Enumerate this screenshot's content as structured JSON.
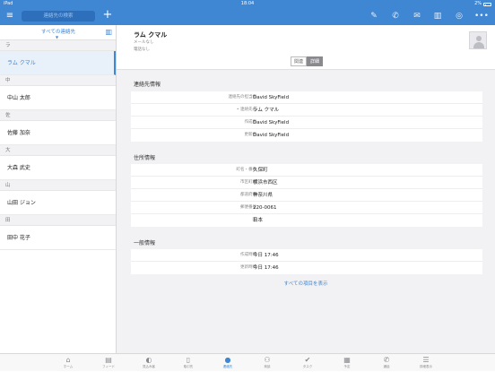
{
  "status_bar": {
    "carrier": "iPad",
    "time": "18:04",
    "battery": "2%"
  },
  "topbar": {
    "search_placeholder": "連絡先の検索",
    "add_label": "+",
    "icons": [
      "menu-icon",
      "pencil-icon",
      "phone-icon",
      "mail-icon",
      "book-icon",
      "location-icon",
      "more-icon"
    ]
  },
  "sidebar": {
    "filter_label": "すべての連絡先",
    "groups": [
      {
        "header": "ラ",
        "contacts": [
          "ラム クマル"
        ]
      },
      {
        "header": "中",
        "contacts": [
          "中山 太郎"
        ]
      },
      {
        "header": "佐",
        "contacts": [
          "佐藤 加奈"
        ]
      },
      {
        "header": "大",
        "contacts": [
          "大森 武史"
        ]
      },
      {
        "header": "山",
        "contacts": [
          "山田 ジョン"
        ]
      },
      {
        "header": "田",
        "contacts": [
          "田中 花子"
        ]
      }
    ],
    "selected": "ラム クマル"
  },
  "detail": {
    "name": "ラム クマル",
    "mail": "メールなし",
    "phone": "電話なし",
    "segments": {
      "related": "関連",
      "details": "詳細"
    },
    "contact_info": {
      "title": "連絡先情報",
      "rows": [
        {
          "label": "連絡先の担当者",
          "value": "David SkyField"
        },
        {
          "label": "• 連絡先名",
          "value": "ラム クマル"
        },
        {
          "label": "作成者",
          "value": "David SkyField"
        },
        {
          "label": "更新者",
          "value": "David SkyField"
        }
      ]
    },
    "address_info": {
      "title": "住所情報",
      "rows": [
        {
          "label": "町名・番地",
          "value": "久保町"
        },
        {
          "label": "市区町村",
          "value": "横浜市西区"
        },
        {
          "label": "都道府県",
          "value": "神奈川県"
        },
        {
          "label": "郵便番号",
          "value": "220-0061"
        },
        {
          "label": "国",
          "value": "日本"
        }
      ]
    },
    "general_info": {
      "title": "一般情報",
      "rows": [
        {
          "label": "作成時間",
          "value": "今日 17:46"
        },
        {
          "label": "更新時間",
          "value": "今日 17:46"
        }
      ]
    },
    "show_all": "すべての項目を表示"
  },
  "tabbar": {
    "items": [
      {
        "label": "ホーム",
        "icon": "home-icon"
      },
      {
        "label": "フィード",
        "icon": "feed-icon"
      },
      {
        "label": "見込み客",
        "icon": "leads-icon"
      },
      {
        "label": "取引先",
        "icon": "accounts-icon"
      },
      {
        "label": "連絡先",
        "icon": "contacts-icon"
      },
      {
        "label": "商談",
        "icon": "deals-icon"
      },
      {
        "label": "タスク",
        "icon": "tasks-icon"
      },
      {
        "label": "予定",
        "icon": "events-icon"
      },
      {
        "label": "通話",
        "icon": "calls-icon"
      },
      {
        "label": "詳細表示",
        "icon": "more-icon"
      }
    ],
    "active": "連絡先"
  }
}
